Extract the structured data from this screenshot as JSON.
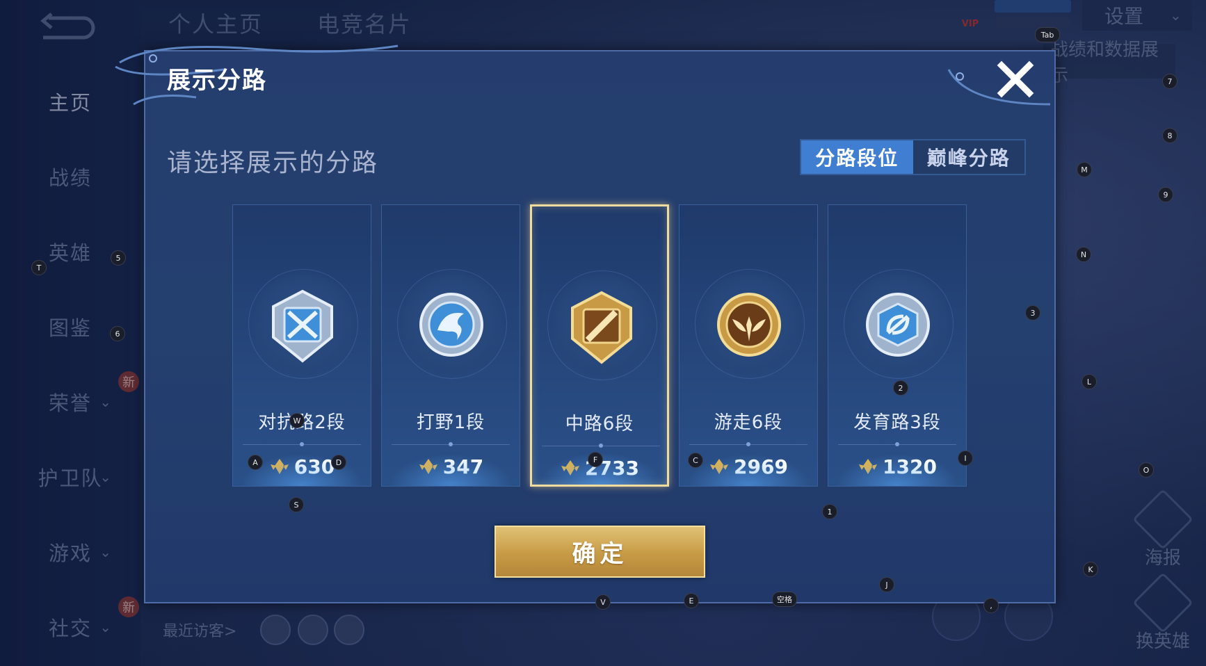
{
  "background": {
    "top_tabs": [
      "个人主页",
      "电竞名片"
    ],
    "settings_label": "设置",
    "vip_label": "VIP",
    "banner_right_text": "战绩和数据展示",
    "sidebar": [
      {
        "label": "主页",
        "active": true,
        "chevron": false,
        "new": false
      },
      {
        "label": "战绩",
        "active": false,
        "chevron": false,
        "new": false
      },
      {
        "label": "英雄",
        "active": false,
        "chevron": false,
        "new": false
      },
      {
        "label": "图鉴",
        "active": false,
        "chevron": false,
        "new": false
      },
      {
        "label": "荣誉",
        "active": false,
        "chevron": true,
        "new": true
      },
      {
        "label": "护卫队",
        "active": false,
        "chevron": true,
        "new": false
      },
      {
        "label": "游戏",
        "active": false,
        "chevron": true,
        "new": false
      },
      {
        "label": "社交",
        "active": false,
        "chevron": true,
        "new": true
      }
    ],
    "new_badge": "新",
    "recent_visitors_label": "最近访客>",
    "poster_label": "海报",
    "change_hero_label": "换英雄"
  },
  "modal": {
    "title": "展示分路",
    "subtitle": "请选择展示的分路",
    "segment_tabs": [
      {
        "label": "分路段位",
        "active": true
      },
      {
        "label": "巅峰分路",
        "active": false
      }
    ],
    "cards": [
      {
        "name": "对抗路2段",
        "score": "630",
        "tier": "silver",
        "icon": "crossed-swords-emblem",
        "selected": false
      },
      {
        "name": "打野1段",
        "score": "347",
        "tier": "silver",
        "icon": "dragon-emblem",
        "selected": false
      },
      {
        "name": "中路6段",
        "score": "2733",
        "tier": "gold",
        "icon": "staff-emblem",
        "selected": true
      },
      {
        "name": "游走6段",
        "score": "2969",
        "tier": "gold",
        "icon": "wings-emblem",
        "selected": false
      },
      {
        "name": "发育路3段",
        "score": "1320",
        "tier": "silver",
        "icon": "bow-emblem",
        "selected": false
      }
    ],
    "confirm_label": "确定",
    "colors": {
      "accent_blue": "#3f7ed0",
      "gold": "#d4b064",
      "selected_border": "#f1dca0"
    }
  },
  "key_hints": [
    "Tab",
    "7",
    "8",
    "M",
    "9",
    "N",
    "3",
    "L",
    "O",
    "K",
    "T",
    "5",
    "6",
    "W",
    "D",
    "A",
    "S",
    "F",
    "C",
    "2",
    "I",
    "1",
    "J",
    "V",
    "E",
    "空格",
    ","
  ]
}
